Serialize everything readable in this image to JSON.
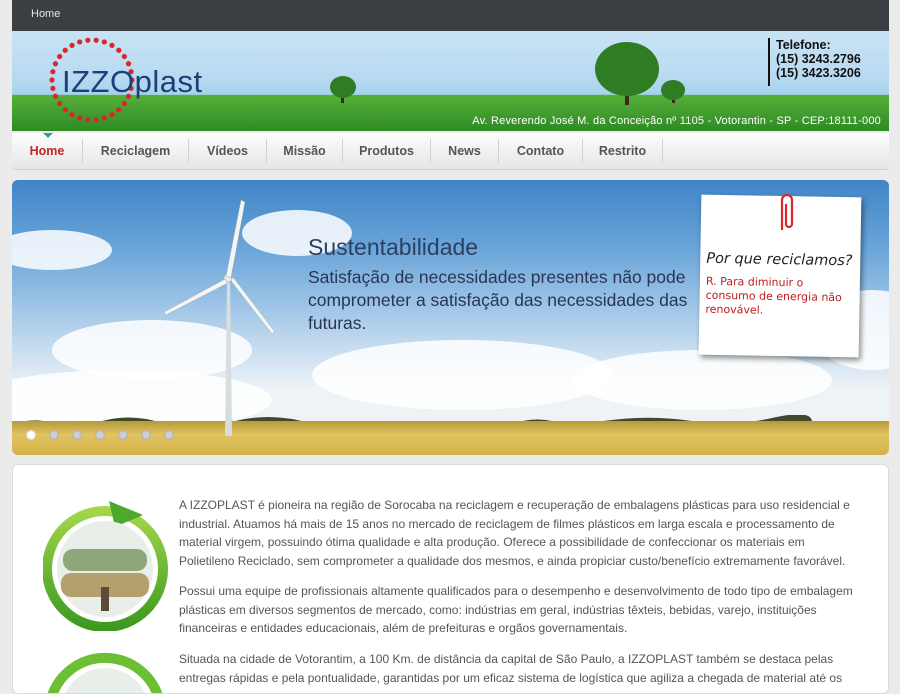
{
  "topbar": {
    "home_link": "Home"
  },
  "header": {
    "logo_text": "IZZOplast",
    "phone_label": "Telefone:",
    "phones": [
      "(15) 3243.2796",
      "(15) 3423.3206"
    ],
    "address": "Av. Reverendo José M. da Conceição nº 1105 - Votorantin - SP - CEP:18111-000"
  },
  "nav": {
    "items": [
      "Home",
      "Reciclagem",
      "Vídeos",
      "Missão",
      "Produtos",
      "News",
      "Contato",
      "Restrito"
    ],
    "active": "Home"
  },
  "slider": {
    "title": "Sustentabilidade",
    "text": "Satisfação de necessidades presentes não pode comprometer a satisfação das necessidades das futuras.",
    "note_question": "Por que reciclamos?",
    "note_answer": "R. Para diminuir o consumo de energia não renovável.",
    "dot_count": 7,
    "active_dot": 1
  },
  "content": {
    "paragraphs": [
      " A IZZOPLAST é pioneira na região de Sorocaba na reciclagem e recuperação de embalagens plásticas para uso residencial e industrial. Atuamos há mais de 15 anos no mercado de reciclagem de filmes plásticos em larga escala e processamento de material virgem, possuindo ótima qualidade e alta produção. Oferece a possibilidade de confeccionar os materiais em Polietileno Reciclado, sem comprometer a qualidade dos mesmos, e ainda propiciar custo/benefício extremamente favorável.",
      "Possui uma equipe de profissionais altamente qualificados para o desempenho e desenvolvimento de todo tipo de embalagem plásticas em diversos segmentos de mercado, como: indústrias em geral, indústrias têxteis, bebidas, varejo, instituições financeiras e entidades educacionais, além de prefeituras e orgãos governamentais.",
      "Situada na cidade de Votorantim, a 100 Km. de distância da capital de São Paulo, a IZZOPLAST também se destaca pelas entregas rápidas e pela pontualidade, garantidas por um eficaz sistema de logística que agiliza a chegada de material até os"
    ]
  },
  "colors": {
    "accent": "#c0272d",
    "topbar": "#3b3f44",
    "logo_blue": "#1c3f7a"
  }
}
